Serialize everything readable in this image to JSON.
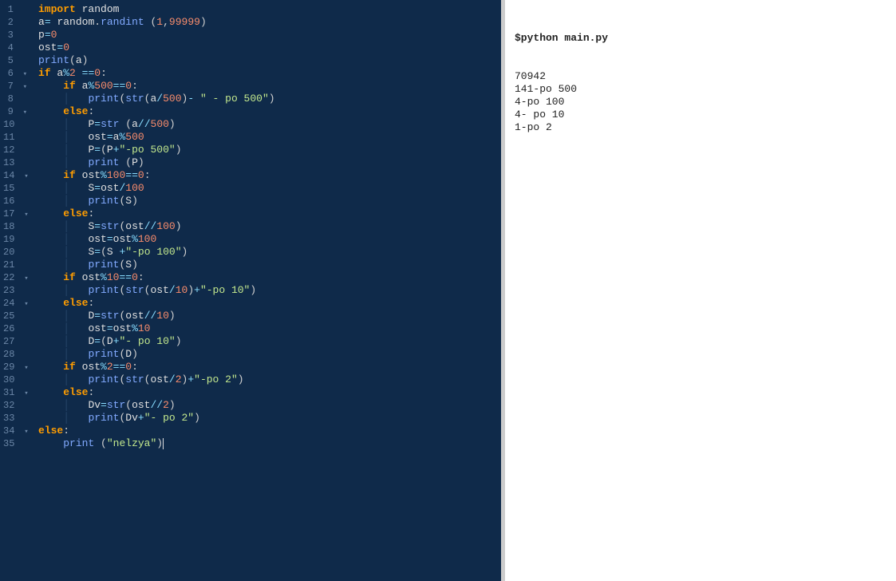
{
  "editor": {
    "lines": [
      {
        "n": 1,
        "fold": "",
        "html": "<span class='kw2'>import</span> <span class='id'>random</span>"
      },
      {
        "n": 2,
        "fold": "",
        "html": "<span class='id'>a</span><span class='op'>=</span> <span class='id'>random</span><span class='punc'>.</span><span class='fn'>randint</span> <span class='punc'>(</span><span class='num'>1</span><span class='punc'>,</span><span class='num'>99999</span><span class='punc'>)</span>"
      },
      {
        "n": 3,
        "fold": "",
        "html": "<span class='id'>p</span><span class='op'>=</span><span class='num'>0</span>"
      },
      {
        "n": 4,
        "fold": "",
        "html": "<span class='id'>ost</span><span class='op'>=</span><span class='num'>0</span>"
      },
      {
        "n": 5,
        "fold": "",
        "html": "<span class='fn'>print</span><span class='punc'>(</span><span class='id'>a</span><span class='punc'>)</span>"
      },
      {
        "n": 6,
        "fold": "▾",
        "html": "<span class='kw2'>if</span> <span class='id'>a</span><span class='op'>%</span><span class='num'>2</span> <span class='op'>==</span><span class='num'>0</span><span class='punc'>:</span>"
      },
      {
        "n": 7,
        "fold": "▾",
        "html": "    <span class='kw2'>if</span> <span class='id'>a</span><span class='op'>%</span><span class='num'>500</span><span class='op'>==</span><span class='num'>0</span><span class='punc'>:</span>"
      },
      {
        "n": 8,
        "fold": "",
        "html": "    <span class='guide'>│</span>   <span class='fn'>print</span><span class='punc'>(</span><span class='fn'>str</span><span class='punc'>(</span><span class='id'>a</span><span class='op'>/</span><span class='num'>500</span><span class='punc'>)</span><span class='op'>-</span> <span class='str'>\" - po 500\"</span><span class='punc'>)</span>"
      },
      {
        "n": 9,
        "fold": "▾",
        "html": "    <span class='kw2'>else</span><span class='punc'>:</span>"
      },
      {
        "n": 10,
        "fold": "",
        "html": "    <span class='guide'>│</span>   <span class='id'>P</span><span class='op'>=</span><span class='fn'>str</span> <span class='punc'>(</span><span class='id'>a</span><span class='op'>//</span><span class='num'>500</span><span class='punc'>)</span>"
      },
      {
        "n": 11,
        "fold": "",
        "html": "    <span class='guide'>│</span>   <span class='id'>ost</span><span class='op'>=</span><span class='id'>a</span><span class='op'>%</span><span class='num'>500</span>"
      },
      {
        "n": 12,
        "fold": "",
        "html": "    <span class='guide'>│</span>   <span class='id'>P</span><span class='op'>=</span><span class='punc'>(</span><span class='id'>P</span><span class='op'>+</span><span class='str'>\"-po 500\"</span><span class='punc'>)</span>"
      },
      {
        "n": 13,
        "fold": "",
        "html": "    <span class='guide'>│</span>   <span class='fn'>print</span> <span class='punc'>(</span><span class='id'>P</span><span class='punc'>)</span>"
      },
      {
        "n": 14,
        "fold": "▾",
        "html": "    <span class='kw2'>if</span> <span class='id'>ost</span><span class='op'>%</span><span class='num'>100</span><span class='op'>==</span><span class='num'>0</span><span class='punc'>:</span>"
      },
      {
        "n": 15,
        "fold": "",
        "html": "    <span class='guide'>│</span>   <span class='id'>S</span><span class='op'>=</span><span class='id'>ost</span><span class='op'>/</span><span class='num'>100</span>"
      },
      {
        "n": 16,
        "fold": "",
        "html": "    <span class='guide'>│</span>   <span class='fn'>print</span><span class='punc'>(</span><span class='id'>S</span><span class='punc'>)</span>"
      },
      {
        "n": 17,
        "fold": "▾",
        "html": "    <span class='kw2'>else</span><span class='punc'>:</span>"
      },
      {
        "n": 18,
        "fold": "",
        "html": "    <span class='guide'>│</span>   <span class='id'>S</span><span class='op'>=</span><span class='fn'>str</span><span class='punc'>(</span><span class='id'>ost</span><span class='op'>//</span><span class='num'>100</span><span class='punc'>)</span>"
      },
      {
        "n": 19,
        "fold": "",
        "html": "    <span class='guide'>│</span>   <span class='id'>ost</span><span class='op'>=</span><span class='id'>ost</span><span class='op'>%</span><span class='num'>100</span>"
      },
      {
        "n": 20,
        "fold": "",
        "html": "    <span class='guide'>│</span>   <span class='id'>S</span><span class='op'>=</span><span class='punc'>(</span><span class='id'>S</span> <span class='op'>+</span><span class='str'>\"-po 100\"</span><span class='punc'>)</span>"
      },
      {
        "n": 21,
        "fold": "",
        "html": "    <span class='guide'>│</span>   <span class='fn'>print</span><span class='punc'>(</span><span class='id'>S</span><span class='punc'>)</span>"
      },
      {
        "n": 22,
        "fold": "▾",
        "html": "    <span class='kw2'>if</span> <span class='id'>ost</span><span class='op'>%</span><span class='num'>10</span><span class='op'>==</span><span class='num'>0</span><span class='punc'>:</span>"
      },
      {
        "n": 23,
        "fold": "",
        "html": "    <span class='guide'>│</span>   <span class='fn'>print</span><span class='punc'>(</span><span class='fn'>str</span><span class='punc'>(</span><span class='id'>ost</span><span class='op'>/</span><span class='num'>10</span><span class='punc'>)</span><span class='op'>+</span><span class='str'>\"-po 10\"</span><span class='punc'>)</span>"
      },
      {
        "n": 24,
        "fold": "▾",
        "html": "    <span class='kw2'>else</span><span class='punc'>:</span>"
      },
      {
        "n": 25,
        "fold": "",
        "html": "    <span class='guide'>│</span>   <span class='id'>D</span><span class='op'>=</span><span class='fn'>str</span><span class='punc'>(</span><span class='id'>ost</span><span class='op'>//</span><span class='num'>10</span><span class='punc'>)</span>"
      },
      {
        "n": 26,
        "fold": "",
        "html": "    <span class='guide'>│</span>   <span class='id'>ost</span><span class='op'>=</span><span class='id'>ost</span><span class='op'>%</span><span class='num'>10</span>"
      },
      {
        "n": 27,
        "fold": "",
        "html": "    <span class='guide'>│</span>   <span class='id'>D</span><span class='op'>=</span><span class='punc'>(</span><span class='id'>D</span><span class='op'>+</span><span class='str'>\"- po 10\"</span><span class='punc'>)</span>"
      },
      {
        "n": 28,
        "fold": "",
        "html": "    <span class='guide'>│</span>   <span class='fn'>print</span><span class='punc'>(</span><span class='id'>D</span><span class='punc'>)</span>"
      },
      {
        "n": 29,
        "fold": "▾",
        "html": "    <span class='kw2'>if</span> <span class='id'>ost</span><span class='op'>%</span><span class='num'>2</span><span class='op'>==</span><span class='num'>0</span><span class='punc'>:</span>"
      },
      {
        "n": 30,
        "fold": "",
        "html": "    <span class='guide'>│</span>   <span class='fn'>print</span><span class='punc'>(</span><span class='fn'>str</span><span class='punc'>(</span><span class='id'>ost</span><span class='op'>/</span><span class='num'>2</span><span class='punc'>)</span><span class='op'>+</span><span class='str'>\"-po 2\"</span><span class='punc'>)</span>"
      },
      {
        "n": 31,
        "fold": "▾",
        "html": "    <span class='kw2'>else</span><span class='punc'>:</span>"
      },
      {
        "n": 32,
        "fold": "",
        "html": "    <span class='guide'>│</span>   <span class='id'>Dv</span><span class='op'>=</span><span class='fn'>str</span><span class='punc'>(</span><span class='id'>ost</span><span class='op'>//</span><span class='num'>2</span><span class='punc'>)</span>"
      },
      {
        "n": 33,
        "fold": "",
        "html": "    <span class='guide'>│</span>   <span class='fn'>print</span><span class='punc'>(</span><span class='id'>Dv</span><span class='op'>+</span><span class='str'>\"- po 2\"</span><span class='punc'>)</span>"
      },
      {
        "n": 34,
        "fold": "▾",
        "html": "<span class='kw2'>else</span><span class='punc'>:</span>"
      },
      {
        "n": 35,
        "fold": "",
        "html": "    <span class='fn'>print</span> <span class='punc'>(</span><span class='str'>\"nelzya\"</span><span class='punc'>)</span><span class='cursor'></span>"
      }
    ]
  },
  "output": {
    "command": "$python main.py",
    "lines": [
      "70942",
      "141-po 500",
      "4-po 100",
      "4- po 10",
      "1-po 2"
    ]
  }
}
